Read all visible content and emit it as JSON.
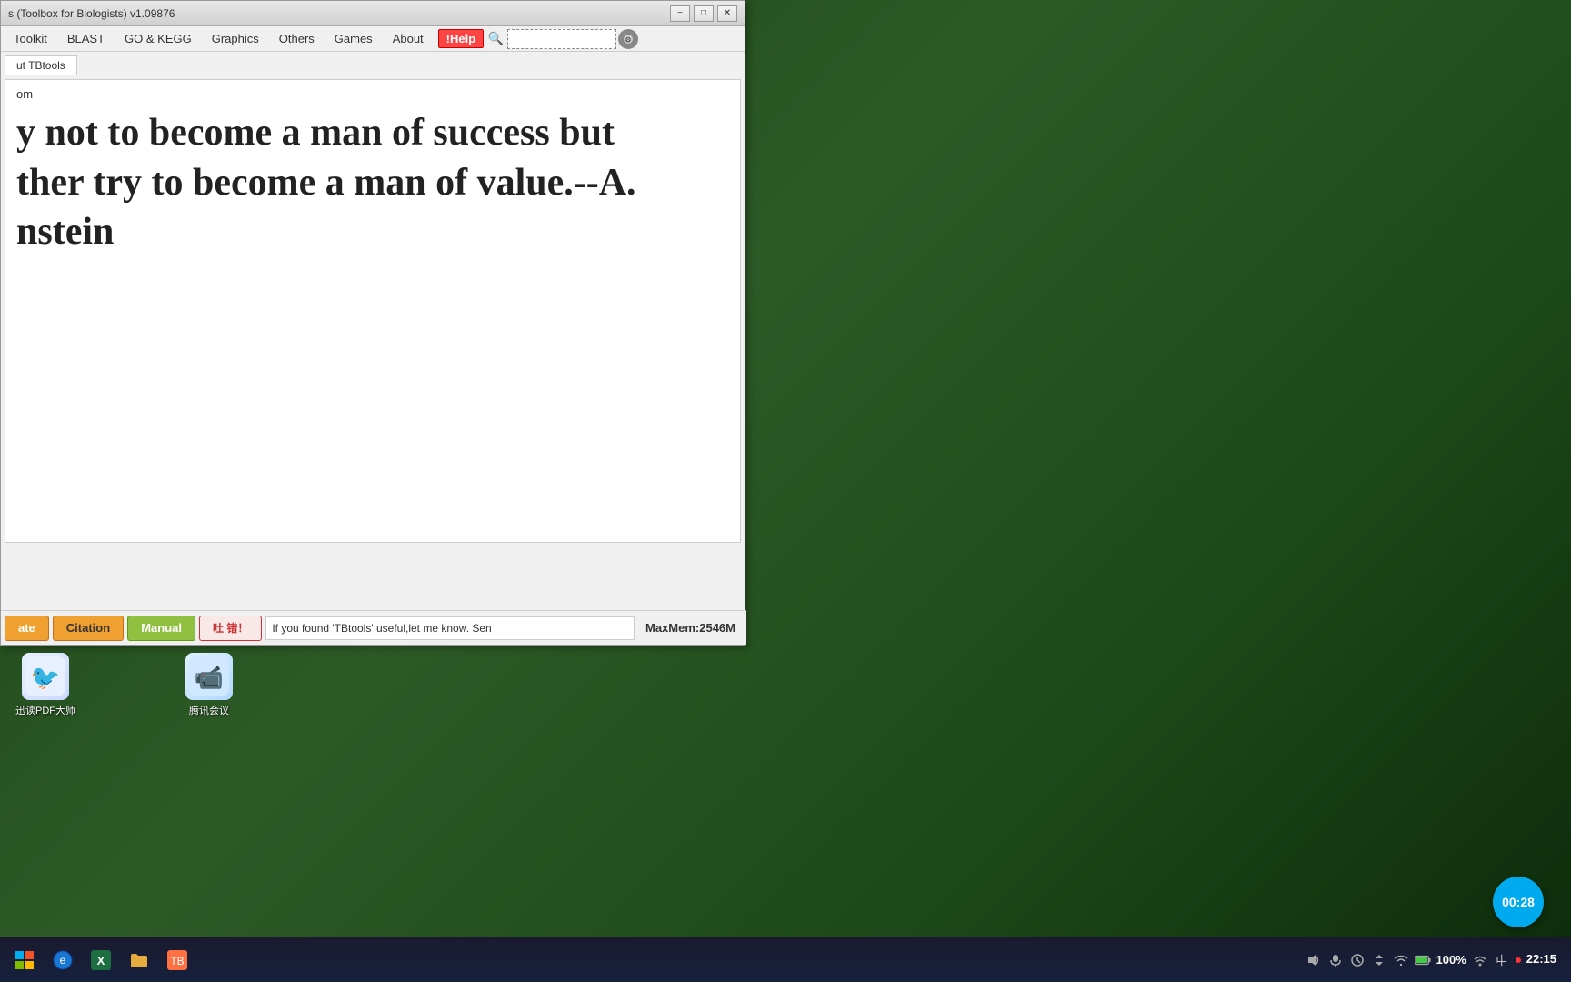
{
  "window": {
    "title": "s (Toolbox for Biologists) v1.09876",
    "minimize_label": "−",
    "maximize_label": "□",
    "close_label": "✕"
  },
  "menubar": {
    "items": [
      {
        "id": "toolkit",
        "label": "Toolkit"
      },
      {
        "id": "blast",
        "label": "BLAST"
      },
      {
        "id": "go_kegg",
        "label": "GO & KEGG"
      },
      {
        "id": "graphics",
        "label": "Graphics"
      },
      {
        "id": "others",
        "label": "Others"
      },
      {
        "id": "games",
        "label": "Games"
      },
      {
        "id": "about",
        "label": "About"
      }
    ],
    "help_label": "!Help",
    "search_placeholder": ""
  },
  "tabs": [
    {
      "id": "about_tbtools",
      "label": "ut TBtools"
    }
  ],
  "content": {
    "top_text": "om",
    "quote": "y not to become a man of success but\nther try to become a man of value.--A.\nnstein"
  },
  "statusbar": {
    "update_label": "ate",
    "citation_label": "Citation",
    "manual_label": "Manual",
    "bug_label": "错！",
    "bug_prefix": "吐",
    "message": "If you found 'TBtools' useful,let me know. Sen",
    "maxmem_label": "MaxMem:2546M"
  },
  "desktop_icons": [
    {
      "id": "pdf-reader",
      "label": "迅读PDF大师",
      "icon": "🐦"
    },
    {
      "id": "tencent-meeting",
      "label": "腾讯会议",
      "icon": "🎥"
    }
  ],
  "taskbar": {
    "start_icon": "⊞",
    "app_icons": [
      "🌐",
      "📊",
      "📁",
      "💼"
    ],
    "tray": {
      "battery": "100%",
      "time": "22:15",
      "input_method": "中"
    }
  },
  "timer": {
    "display": "00:28"
  }
}
